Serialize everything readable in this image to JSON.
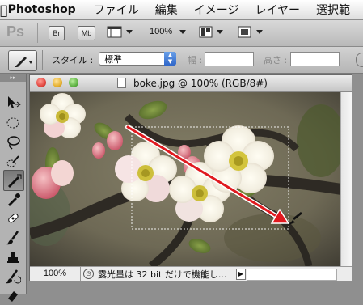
{
  "menubar": {
    "app_name": "Photoshop",
    "items": [
      "ファイル",
      "編集",
      "イメージ",
      "レイヤー",
      "選択範"
    ]
  },
  "appbar": {
    "logo": "Ps",
    "bridge_label": "Br",
    "minibridge_label": "Mb",
    "zoom": "100%"
  },
  "options": {
    "style_label": "スタイル :",
    "style_value": "標準",
    "width_label": "幅 :",
    "height_label": "高さ :"
  },
  "document": {
    "title": "boke.jpg @ 100% (RGB/8#)",
    "zoom": "100%",
    "status_message": "露光量は 32 bit だけで機能し..."
  },
  "colors": {
    "arrow": "#e0191f",
    "close": "#e2463f",
    "minimize": "#e6b02e",
    "zoom": "#5fb344"
  },
  "icons": {
    "apple": "apple-icon",
    "marquee_tool": "rectangular-marquee-icon"
  }
}
